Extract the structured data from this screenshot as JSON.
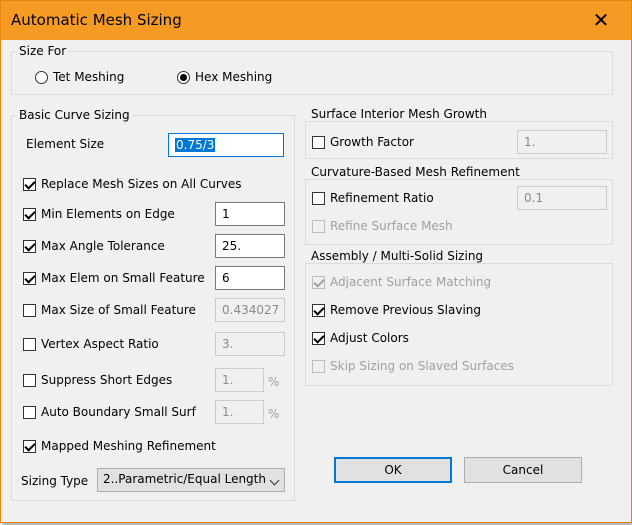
{
  "window": {
    "title": "Automatic Mesh Sizing",
    "close_glyph": "✕"
  },
  "size_for": {
    "label": "Size For",
    "options": [
      {
        "label": "Tet Meshing",
        "selected": false
      },
      {
        "label": "Hex Meshing",
        "selected": true
      }
    ]
  },
  "basic": {
    "label": "Basic Curve Sizing",
    "element_size_label": "Element Size",
    "element_size_value": "0.75/3",
    "replace_label": "Replace Mesh Sizes on All Curves",
    "rows": [
      {
        "label": "Min Elements on Edge",
        "checked": true,
        "value": "1",
        "enabled": true
      },
      {
        "label": "Max Angle Tolerance",
        "checked": true,
        "value": "25.",
        "enabled": true
      },
      {
        "label": "Max Elem on Small Feature",
        "checked": true,
        "value": "6",
        "enabled": true
      },
      {
        "label": "Max Size of Small Feature",
        "checked": false,
        "value": "0.434027",
        "enabled": false
      },
      {
        "label": "Vertex Aspect Ratio",
        "checked": false,
        "value": "3.",
        "enabled": false
      },
      {
        "label": "Suppress Short Edges",
        "checked": false,
        "value": "1.",
        "enabled": false,
        "unit": "%"
      },
      {
        "label": "Auto Boundary Small Surf",
        "checked": false,
        "value": "1.",
        "enabled": false,
        "unit": "%"
      }
    ],
    "mapped_label": "Mapped Meshing Refinement",
    "sizing_type_label": "Sizing Type",
    "sizing_type_value": "2..Parametric/Equal Length"
  },
  "surface": {
    "label": "Surface Interior Mesh Growth",
    "growth_label": "Growth  Factor",
    "growth_value": "1."
  },
  "curvature": {
    "label": "Curvature-Based Mesh Refinement",
    "refinement_label": "Refinement Ratio",
    "refinement_value": "0.1",
    "refine_surface_label": "Refine Surface Mesh"
  },
  "assembly": {
    "label": "Assembly / Multi-Solid Sizing",
    "adjacent_label": "Adjacent Surface Matching",
    "remove_label": "Remove Previous Slaving",
    "adjust_label": "Adjust Colors",
    "skip_label": "Skip Sizing on Slaved Surfaces"
  },
  "buttons": {
    "ok": "OK",
    "cancel": "Cancel"
  }
}
